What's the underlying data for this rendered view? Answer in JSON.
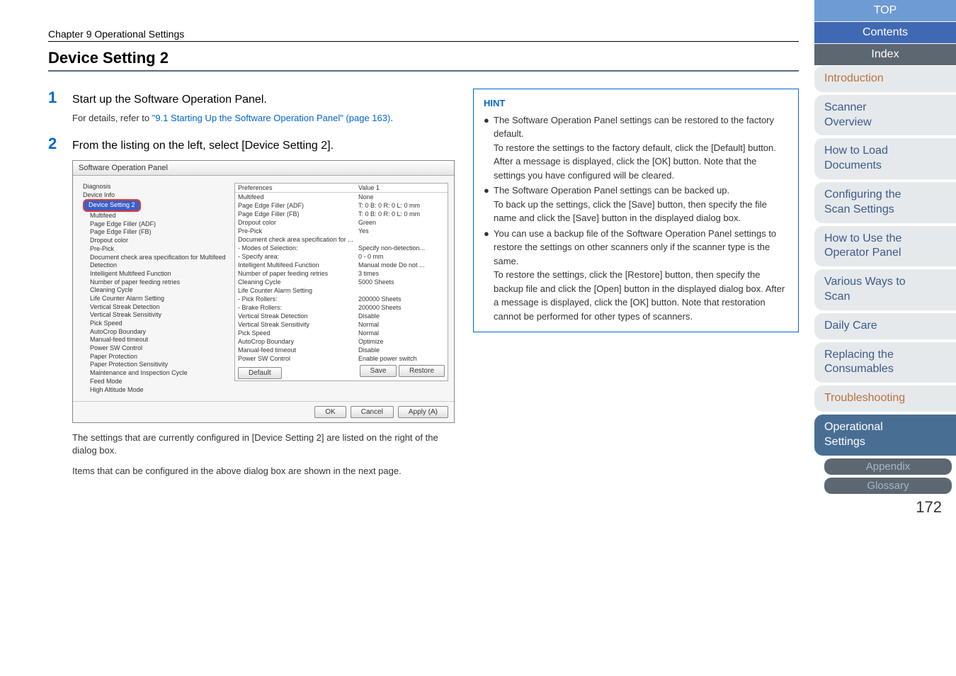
{
  "chapter": "Chapter 9 Operational Settings",
  "section_title": "Device Setting 2",
  "steps": {
    "s1": {
      "num": "1",
      "text": "Start up the Software Operation Panel.",
      "sub_prefix": "For details, refer to ",
      "sub_link": "\"9.1 Starting Up the Software Operation Panel\" (page 163)",
      "sub_suffix": "."
    },
    "s2": {
      "num": "2",
      "text": "From the listing on the left, select [Device Setting 2]."
    }
  },
  "dialog": {
    "title": "Software Operation Panel",
    "tree": {
      "t0": "Diagnosis",
      "t1": "Device Info",
      "t2_hl": "Device Setting 2",
      "t3": "Multifeed",
      "t4": "Page Edge Filler (ADF)",
      "t5": "Page Edge Filler (FB)",
      "t6": "Dropout color",
      "t7": "Pre-Pick",
      "t8": "Document check area specification for Multifeed Detection",
      "t9": "Intelligent Multifeed Function",
      "t10": "Number of paper feeding retries",
      "t11": "Cleaning Cycle",
      "t12": "Life Counter Alarm Setting",
      "t13": "Vertical Streak Detection",
      "t14": "Vertical Streak Sensitivity",
      "t15": "Pick Speed",
      "t16": "AutoCrop Boundary",
      "t17": "Manual-feed timeout",
      "t18": "Power SW Control",
      "t19": "Paper Protection",
      "t20": "Paper Protection Sensitivity",
      "t21": "Maintenance and Inspection Cycle",
      "t22": "Feed Mode",
      "t23": "High Altitude Mode"
    },
    "prefs_header": {
      "c1": "Preferences",
      "c2": "Value 1"
    },
    "prefs": [
      {
        "c1": "Multifeed",
        "c2": "None"
      },
      {
        "c1": "Page Edge Filler (ADF)",
        "c2": "T: 0  B: 0  R: 0  L: 0 mm"
      },
      {
        "c1": "Page Edge Filler (FB)",
        "c2": "T: 0  B: 0  R: 0  L: 0 mm"
      },
      {
        "c1": "Dropout color",
        "c2": "Green"
      },
      {
        "c1": "Pre-Pick",
        "c2": "Yes"
      },
      {
        "c1": "Document check area specification for ...",
        "c2": ""
      },
      {
        "c1": " - Modes of Selection:",
        "c2": "Specify non-detection..."
      },
      {
        "c1": " - Specify area:",
        "c2": "0 - 0 mm"
      },
      {
        "c1": "Intelligent Multifeed Function",
        "c2": "Manual mode  Do not ..."
      },
      {
        "c1": "Number of paper feeding retries",
        "c2": "3 times"
      },
      {
        "c1": "Cleaning Cycle",
        "c2": "5000 Sheets"
      },
      {
        "c1": "Life Counter Alarm Setting",
        "c2": ""
      },
      {
        "c1": " - Pick Rollers:",
        "c2": "200000 Sheets"
      },
      {
        "c1": " - Brake Rollers:",
        "c2": "200000 Sheets"
      },
      {
        "c1": "Vertical Streak Detection",
        "c2": "Disable"
      },
      {
        "c1": "Vertical Streak Sensitivity",
        "c2": "Normal"
      },
      {
        "c1": "Pick Speed",
        "c2": "Normal"
      },
      {
        "c1": "AutoCrop Boundary",
        "c2": "Optimize"
      },
      {
        "c1": "Manual-feed timeout",
        "c2": "Disable"
      },
      {
        "c1": "Power SW Control",
        "c2": "Enable power switch"
      }
    ],
    "btn_default": "Default",
    "btn_save": "Save",
    "btn_restore": "Restore",
    "btn_ok": "OK",
    "btn_cancel": "Cancel",
    "btn_apply": "Apply (A)"
  },
  "post_notes": {
    "n1": "The settings that are currently configured in [Device Setting 2] are listed on the right of the dialog box.",
    "n2": "Items that can be configured in the above dialog box are shown in the next page."
  },
  "hint": {
    "label": "HINT",
    "b1": "The Software Operation Panel settings can be restored to the factory default.",
    "b1_cont": "To restore the settings to the factory default, click the [Default] button. After a message is displayed, click the [OK] button. Note that the settings you have configured will be cleared.",
    "b2": "The Software Operation Panel settings can be backed up.",
    "b2_cont": "To back up the settings, click the [Save] button, then specify the file name and click the [Save] button in the displayed dialog box.",
    "b3": "You can use a backup file of the Software Operation Panel settings to restore the settings on other scanners only if the scanner type is the same.",
    "b3_cont": "To restore the settings, click the [Restore] button, then specify the backup file and click the [Open] button in the displayed dialog box. After a message is displayed, click the [OK] button. Note that restoration cannot be performed for other types of scanners."
  },
  "sidebar": {
    "top": "TOP",
    "contents": "Contents",
    "index": "Index",
    "intro": "Introduction",
    "scanner_l1": "Scanner",
    "scanner_l2": "Overview",
    "load_l1": "How to Load",
    "load_l2": "Documents",
    "config_l1": "Configuring the",
    "config_l2": "Scan Settings",
    "use_l1": "How to Use the",
    "use_l2": "Operator Panel",
    "ways_l1": "Various Ways to",
    "ways_l2": "Scan",
    "daily": "Daily Care",
    "replace_l1": "Replacing the",
    "replace_l2": "Consumables",
    "trouble": "Troubleshooting",
    "op_l1": "Operational",
    "op_l2": "Settings",
    "appendix": "Appendix",
    "glossary": "Glossary"
  },
  "page_num": "172"
}
